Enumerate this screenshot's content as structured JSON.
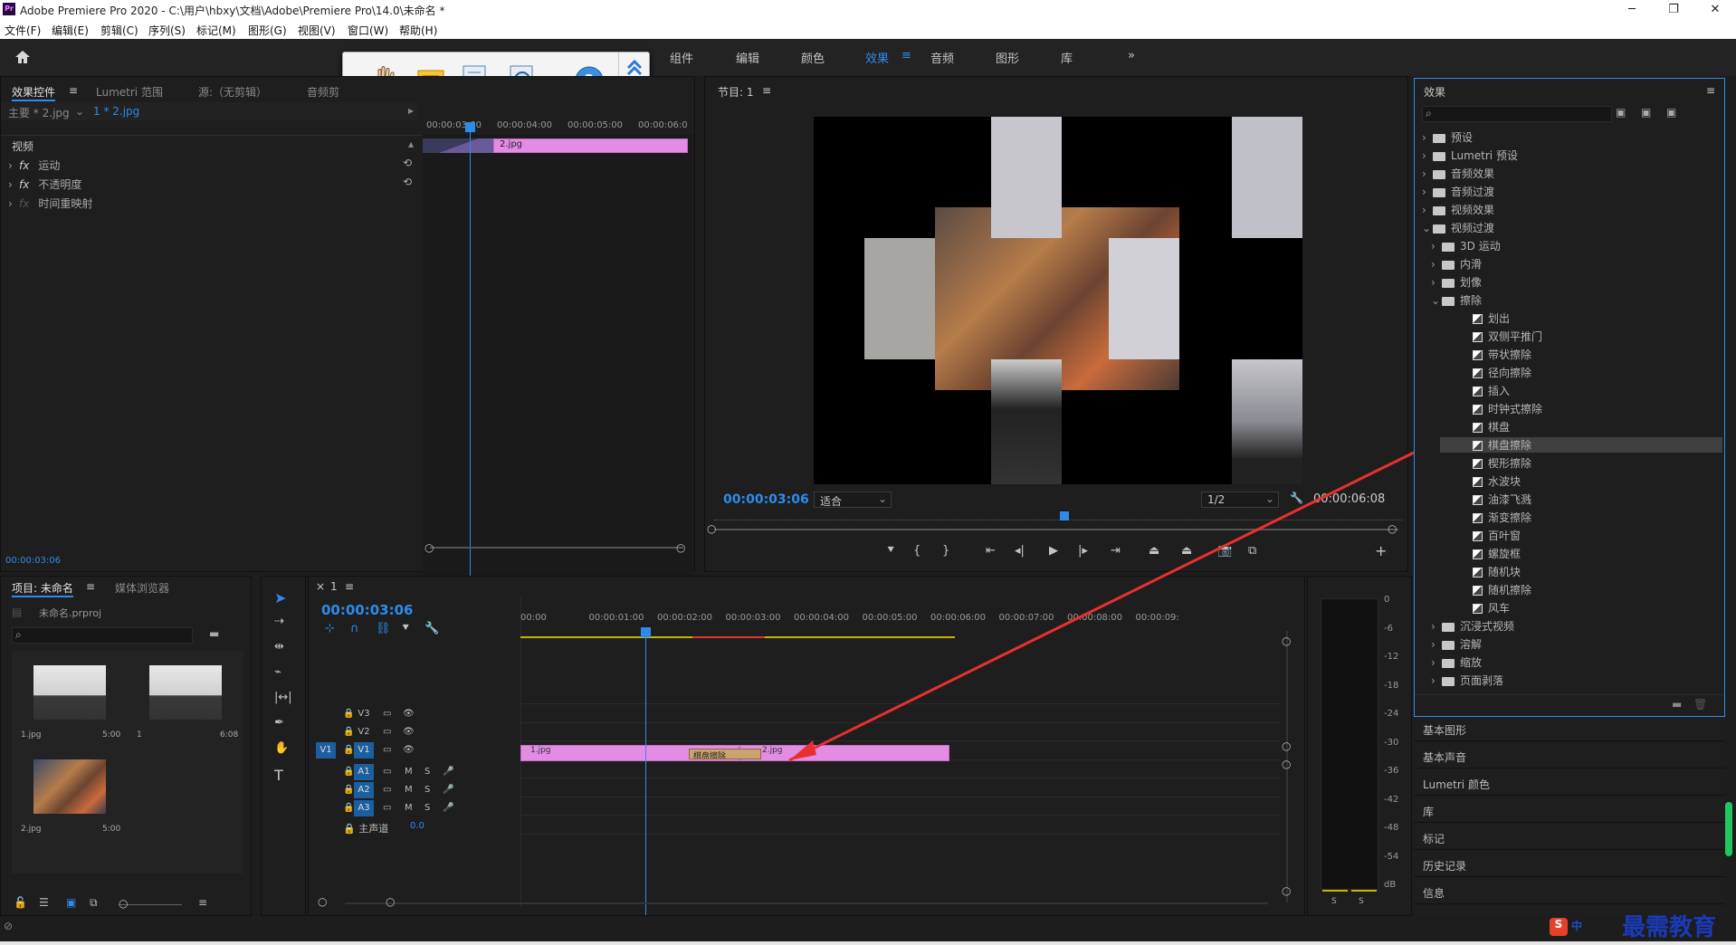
{
  "window": {
    "title": "Adobe Premiere Pro 2020 - C:\\用户\\hbxy\\文档\\Adobe\\Premiere Pro\\14.0\\未命名 *",
    "app_icon": "Pr",
    "min": "─",
    "max": "❐",
    "close": "✕"
  },
  "menu": [
    "文件(F)",
    "编辑(E)",
    "剪辑(C)",
    "序列(S)",
    "标记(M)",
    "图形(G)",
    "视图(V)",
    "窗口(W)",
    "帮助(H)"
  ],
  "workspaces": [
    "组件",
    "编辑",
    "颜色",
    "效果",
    "音频",
    "图形",
    "库"
  ],
  "workspace_active": "效果",
  "workspace_more": "»",
  "effect_controls": {
    "tabs": [
      "效果控件",
      "Lumetri 范围",
      "源:（无剪辑）",
      "音频剪"
    ],
    "clip_label": "主要 * 2.jpg",
    "seq_label": "1 * 2.jpg",
    "times": [
      "00:00:03:00",
      "00:00:04:00",
      "00:00:05:00",
      "00:00:06:0"
    ],
    "section": "视频",
    "props": [
      "运动",
      "不透明度",
      "时间重映射"
    ],
    "clip_name": "2.jpg",
    "timecode": "00:00:03:06"
  },
  "program": {
    "title": "节目: 1",
    "timecode": "00:00:03:06",
    "fit": "适合",
    "quality": "1/2",
    "duration": "00:00:06:08"
  },
  "floating_toolbar": {
    "icons": [
      "hand-icon",
      "comment-icon",
      "export-icon",
      "search-zoom-icon",
      "help-icon"
    ]
  },
  "effects": {
    "title": "效果",
    "tree": [
      {
        "label": "预设",
        "level": 0,
        "type": "folder",
        "open": false
      },
      {
        "label": "Lumetri 预设",
        "level": 0,
        "type": "folder",
        "open": false
      },
      {
        "label": "音频效果",
        "level": 0,
        "type": "folder",
        "open": false
      },
      {
        "label": "音频过渡",
        "level": 0,
        "type": "folder",
        "open": false
      },
      {
        "label": "视频效果",
        "level": 0,
        "type": "folder",
        "open": false
      },
      {
        "label": "视频过渡",
        "level": 0,
        "type": "folder",
        "open": true
      },
      {
        "label": "3D 运动",
        "level": 1,
        "type": "folder",
        "open": false
      },
      {
        "label": "内滑",
        "level": 1,
        "type": "folder",
        "open": false
      },
      {
        "label": "划像",
        "level": 1,
        "type": "folder",
        "open": false
      },
      {
        "label": "擦除",
        "level": 1,
        "type": "folder",
        "open": true
      },
      {
        "label": "划出",
        "level": 2,
        "type": "fx"
      },
      {
        "label": "双侧平推门",
        "level": 2,
        "type": "fx"
      },
      {
        "label": "带状擦除",
        "level": 2,
        "type": "fx"
      },
      {
        "label": "径向擦除",
        "level": 2,
        "type": "fx"
      },
      {
        "label": "插入",
        "level": 2,
        "type": "fx"
      },
      {
        "label": "时钟式擦除",
        "level": 2,
        "type": "fx"
      },
      {
        "label": "棋盘",
        "level": 2,
        "type": "fx"
      },
      {
        "label": "棋盘擦除",
        "level": 2,
        "type": "fx",
        "selected": true
      },
      {
        "label": "楔形擦除",
        "level": 2,
        "type": "fx"
      },
      {
        "label": "水波块",
        "level": 2,
        "type": "fx"
      },
      {
        "label": "油漆飞溅",
        "level": 2,
        "type": "fx"
      },
      {
        "label": "渐变擦除",
        "level": 2,
        "type": "fx"
      },
      {
        "label": "百叶窗",
        "level": 2,
        "type": "fx"
      },
      {
        "label": "螺旋框",
        "level": 2,
        "type": "fx"
      },
      {
        "label": "随机块",
        "level": 2,
        "type": "fx"
      },
      {
        "label": "随机擦除",
        "level": 2,
        "type": "fx"
      },
      {
        "label": "风车",
        "level": 2,
        "type": "fx"
      },
      {
        "label": "沉浸式视频",
        "level": 1,
        "type": "folder",
        "open": false
      },
      {
        "label": "溶解",
        "level": 1,
        "type": "folder",
        "open": false
      },
      {
        "label": "缩放",
        "level": 1,
        "type": "folder",
        "open": false
      },
      {
        "label": "页面剥落",
        "level": 1,
        "type": "folder",
        "open": false
      }
    ],
    "collapsed": [
      "基本图形",
      "基本声音",
      "Lumetri 颜色",
      "库",
      "标记",
      "历史记录",
      "信息"
    ]
  },
  "project": {
    "tabs": [
      "项目: 未命名",
      "媒体浏览器"
    ],
    "file": "未命名.prproj",
    "items": [
      {
        "name": "1.jpg",
        "dur": "5:00"
      },
      {
        "name": "1",
        "dur": "6:08"
      },
      {
        "name": "2.jpg",
        "dur": "5:00"
      }
    ]
  },
  "timeline": {
    "tab": "1",
    "timecode": "00:00:03:06",
    "ruler": [
      "00:00",
      "00:00:01:00",
      "00:00:02:00",
      "00:00:03:00",
      "00:00:04:00",
      "00:00:05:00",
      "00:00:06:00",
      "00:00:07:00",
      "00:00:08:00",
      "00:00:09:"
    ],
    "video_tracks": [
      "V3",
      "V2",
      "V1"
    ],
    "audio_tracks": [
      "A1",
      "A2",
      "A3"
    ],
    "source_patch": [
      "V1"
    ],
    "master": "主声道",
    "master_val": "0.0",
    "clips": [
      {
        "name": "1.jpg"
      },
      {
        "name": "2.jpg"
      }
    ],
    "transition": "棋盘擦除",
    "mute": "M",
    "solo": "S"
  },
  "meter": {
    "scale": [
      "0",
      "-6",
      "-12",
      "-18",
      "-24",
      "-30",
      "-36",
      "-42",
      "-48",
      "-54",
      "dB"
    ],
    "solo": [
      "S",
      "S"
    ]
  },
  "watermark": {
    "text": "最需教育",
    "ime": "中"
  }
}
